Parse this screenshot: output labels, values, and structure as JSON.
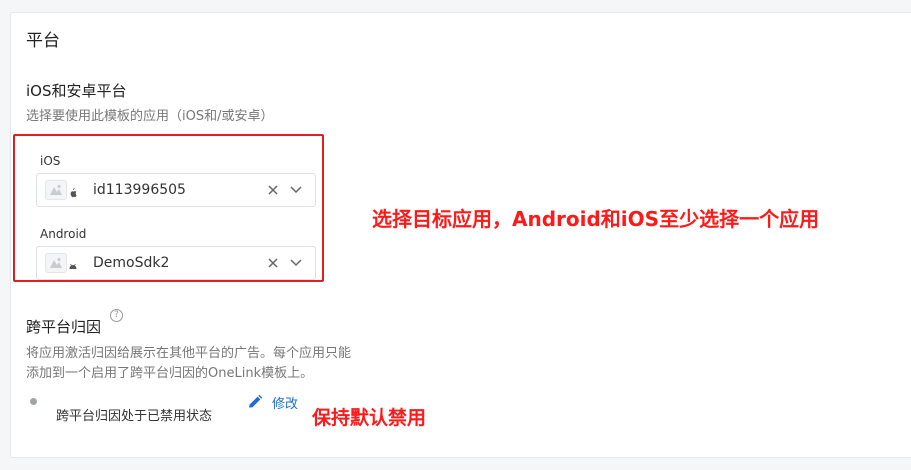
{
  "section": {
    "title": "平台"
  },
  "platforms": {
    "title": "iOS和安卓平台",
    "description": "选择要使用此模板的应用（iOS和/或安卓）",
    "ios": {
      "label": "iOS",
      "value": "id113996505",
      "icon": "apple-icon"
    },
    "android": {
      "label": "Android",
      "value": "DemoSdk2",
      "icon": "android-icon"
    }
  },
  "cross_platform": {
    "title": "跨平台归因",
    "description_line1": "将应用激活归因给展示在其他平台的广告。每个应用只能",
    "description_line2": "添加到一个启用了跨平台归因的OneLink模板上。",
    "status": "跨平台归因处于已禁用状态",
    "edit_label": "修改"
  },
  "annotations": {
    "select_apps": "选择目标应用，Android和iOS至少选择一个应用",
    "keep_default": "保持默认禁用"
  },
  "colors": {
    "annotation_red": "#ff1a1a",
    "link_blue": "#1a6fd6",
    "highlight_border": "#e02020"
  }
}
